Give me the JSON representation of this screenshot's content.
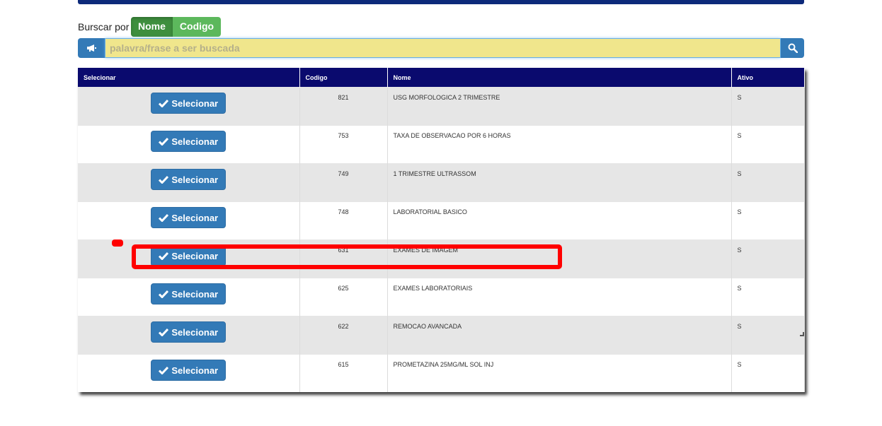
{
  "search": {
    "label": "Burscar por",
    "modes": [
      {
        "label": "Nome",
        "active": true
      },
      {
        "label": "Codigo",
        "active": false
      }
    ],
    "placeholder": "palavra/frase a ser buscada",
    "value": ""
  },
  "table": {
    "columns": [
      "Selecionar",
      "Codigo",
      "Nome",
      "Ativo"
    ],
    "button_label": "Selecionar",
    "rows": [
      {
        "codigo": "821",
        "nome": "USG MORFOLOGICA 2 TRIMESTRE",
        "ativo": "S"
      },
      {
        "codigo": "753",
        "nome": "TAXA DE OBSERVACAO POR 6 HORAS",
        "ativo": "S"
      },
      {
        "codigo": "749",
        "nome": "1 TRIMESTRE ULTRASSOM",
        "ativo": "S"
      },
      {
        "codigo": "748",
        "nome": "LABORATORIAL BASICO",
        "ativo": "S"
      },
      {
        "codigo": "631",
        "nome": "EXAMES DE IMAGEM",
        "ativo": "S"
      },
      {
        "codigo": "625",
        "nome": "EXAMES LABORATORIAIS",
        "ativo": "S"
      },
      {
        "codigo": "622",
        "nome": "REMOCAO AVANCADA",
        "ativo": "S"
      },
      {
        "codigo": "615",
        "nome": "PROMETAZINA 25MG/ML SOL INJ",
        "ativo": "S"
      }
    ]
  },
  "icons": {
    "search_addon": "megaphone-icon",
    "search_button": "search-icon",
    "select": "check-icon"
  },
  "colors": {
    "header_bg": "#0a0a6e",
    "primary": "#337ab7",
    "toggle_active": "#3e8f3e",
    "toggle_inactive": "#5cb85c",
    "search_bg": "#f0e68c",
    "highlight": "#ff0000"
  }
}
